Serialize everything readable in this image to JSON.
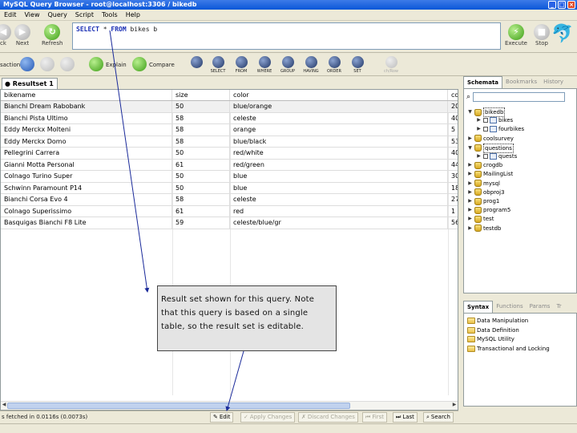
{
  "window": {
    "title": "MySQL Query Browser - root@localhost:3306 / bikedb"
  },
  "menu": [
    "Edit",
    "View",
    "Query",
    "Script",
    "Tools",
    "Help"
  ],
  "query_toolbar": {
    "back_label": "ck",
    "next_label": "Next",
    "refresh_label": "Refresh",
    "execute_label": "Execute",
    "stop_label": "Stop",
    "query_text_keyword1": "SELECT",
    "query_text_star": "*",
    "query_text_keyword2": "FROM",
    "query_text_rest": "bikes b"
  },
  "toolbar2": {
    "transaction_label": "saction",
    "explain_label": "Explain",
    "compare_label": "Compare",
    "sql_buttons": [
      "SELECT",
      "FROM",
      "WHERE",
      "GROUP",
      "HAVING",
      "ORDER",
      "SET"
    ],
    "last_label": "ch/Row"
  },
  "result_tab": {
    "label": "Resultset 1"
  },
  "grid": {
    "headers": [
      "bikename",
      "size",
      "color",
      "co"
    ],
    "rows": [
      [
        "Bianchi Dream Rabobank",
        "50",
        "blue/orange",
        "20"
      ],
      [
        "Bianchi Pista Ultimo",
        "58",
        "celeste",
        "40"
      ],
      [
        "Eddy Merckx Molteni",
        "58",
        "orange",
        "5"
      ],
      [
        "Eddy Merckx Domo",
        "58",
        "blue/black",
        "53"
      ],
      [
        "Pellegrini Carrera",
        "50",
        "red/white",
        "40"
      ],
      [
        "Gianni Motta Personal",
        "61",
        "red/green",
        "44"
      ],
      [
        "Colnago Turino Super",
        "50",
        "blue",
        "30"
      ],
      [
        "Schwinn Paramount P14",
        "50",
        "blue",
        "18"
      ],
      [
        "Bianchi Corsa Evo 4",
        "58",
        "celeste",
        "27"
      ],
      [
        "Colnago Superissimo",
        "61",
        "red",
        "1"
      ],
      [
        "Basquigas Bianchi F8 Lite",
        "59",
        "celeste/blue/gr",
        "56"
      ]
    ]
  },
  "status": {
    "text": "s fetched in 0.0116s (0.0073s)",
    "edit_label": "Edit",
    "apply_label": "Apply Changes",
    "discard_label": "Discard Changes",
    "first_label": "First",
    "last_label": "Last",
    "search_label": "Search"
  },
  "schemata": {
    "tabs": [
      "Schemata",
      "Bookmarks",
      "History"
    ],
    "items": [
      {
        "label": "bikedb",
        "level": 0,
        "type": "db",
        "expander": "▼"
      },
      {
        "label": "bikes",
        "level": 1,
        "type": "table",
        "expander": "▶"
      },
      {
        "label": "fourbikes",
        "level": 1,
        "type": "table",
        "expander": "▶"
      },
      {
        "label": "coolsurvey",
        "level": 0,
        "type": "db",
        "expander": "▶"
      },
      {
        "label": "questions",
        "level": 0,
        "type": "db",
        "expander": "▼"
      },
      {
        "label": "quests",
        "level": 1,
        "type": "table",
        "expander": "▶"
      },
      {
        "label": "crogdb",
        "level": 0,
        "type": "db",
        "expander": "▶"
      },
      {
        "label": "MailingList",
        "level": 0,
        "type": "db",
        "expander": "▶"
      },
      {
        "label": "mysql",
        "level": 0,
        "type": "db",
        "expander": "▶"
      },
      {
        "label": "obproj3",
        "level": 0,
        "type": "db",
        "expander": "▶"
      },
      {
        "label": "prog1",
        "level": 0,
        "type": "db",
        "expander": "▶"
      },
      {
        "label": "program5",
        "level": 0,
        "type": "db",
        "expander": "▶"
      },
      {
        "label": "test",
        "level": 0,
        "type": "db",
        "expander": "▶"
      },
      {
        "label": "testdb",
        "level": 0,
        "type": "db",
        "expander": "▶"
      }
    ]
  },
  "syntax": {
    "tabs": [
      "Syntax",
      "Functions",
      "Params",
      "Tr"
    ],
    "items": [
      "Data Manipulation",
      "Data Definition",
      "MySQL Utility",
      "Transactional and Locking"
    ]
  },
  "callout": {
    "text": "Result set shown for this query. Note that this query is based on a single table, so the result set is editable."
  }
}
